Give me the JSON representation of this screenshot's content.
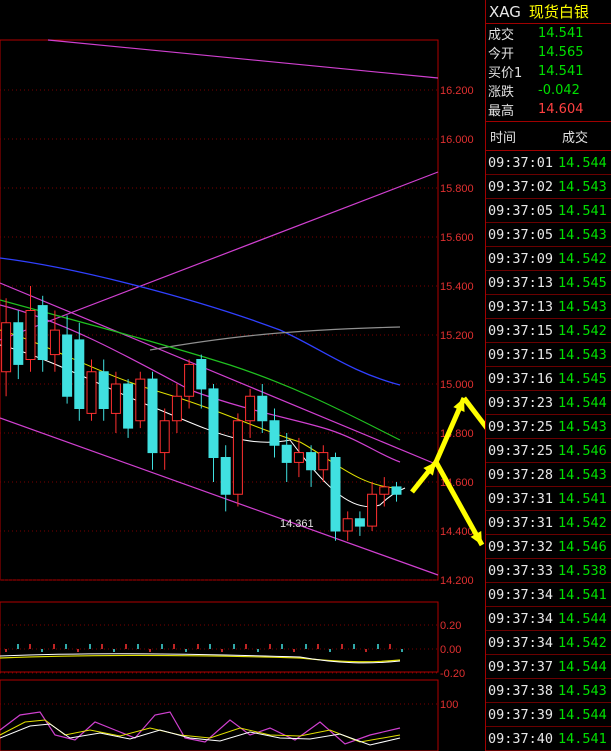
{
  "panel": {
    "symbol": "XAG",
    "name": "现货白银",
    "quotes": [
      {
        "label": "成交",
        "value": "14.541",
        "color": "#00e000"
      },
      {
        "label": "今开",
        "value": "14.565",
        "color": "#00e000"
      },
      {
        "label": "买价1",
        "value": "14.541",
        "color": "#00e000"
      },
      {
        "label": "涨跌",
        "value": "-0.042",
        "color": "#00e000"
      },
      {
        "label": "最高",
        "value": "14.604",
        "color": "#ff4040"
      }
    ],
    "header_time": "时间",
    "header_price": "成交",
    "ticks": [
      {
        "time": "09:37:01",
        "price": "14.544"
      },
      {
        "time": "09:37:02",
        "price": "14.543"
      },
      {
        "time": "09:37:05",
        "price": "14.541"
      },
      {
        "time": "09:37:05",
        "price": "14.543"
      },
      {
        "time": "09:37:09",
        "price": "14.542"
      },
      {
        "time": "09:37:13",
        "price": "14.545"
      },
      {
        "time": "09:37:13",
        "price": "14.543"
      },
      {
        "time": "09:37:15",
        "price": "14.542"
      },
      {
        "time": "09:37:15",
        "price": "14.543"
      },
      {
        "time": "09:37:16",
        "price": "14.545"
      },
      {
        "time": "09:37:23",
        "price": "14.544"
      },
      {
        "time": "09:37:25",
        "price": "14.543"
      },
      {
        "time": "09:37:25",
        "price": "14.546"
      },
      {
        "time": "09:37:28",
        "price": "14.543"
      },
      {
        "time": "09:37:31",
        "price": "14.541"
      },
      {
        "time": "09:37:31",
        "price": "14.542"
      },
      {
        "time": "09:37:32",
        "price": "14.546"
      },
      {
        "time": "09:37:33",
        "price": "14.538"
      },
      {
        "time": "09:37:34",
        "price": "14.541"
      },
      {
        "time": "09:37:34",
        "price": "14.544"
      },
      {
        "time": "09:37:34",
        "price": "14.542"
      },
      {
        "time": "09:37:37",
        "price": "14.544"
      },
      {
        "time": "09:37:38",
        "price": "14.543"
      },
      {
        "time": "09:37:39",
        "price": "14.544"
      },
      {
        "time": "09:37:40",
        "price": "14.541"
      }
    ]
  },
  "chart": {
    "price_ticks": [
      "16.200",
      "16.000",
      "15.800",
      "15.600",
      "15.400",
      "15.200",
      "15.000",
      "14.800",
      "14.600",
      "14.400",
      "14.200"
    ],
    "price_values": [
      16.2,
      16.0,
      15.8,
      15.6,
      15.4,
      15.2,
      15.0,
      14.8,
      14.6,
      14.4,
      14.2
    ],
    "low_label": "14.361",
    "macd_ticks": [
      "0.20",
      "0.00",
      "-0.20"
    ],
    "kdj_ticks": [
      "100"
    ],
    "candles": [
      [
        0.5,
        15.05,
        15.25,
        14.95,
        15.35
      ],
      [
        1.5,
        15.25,
        15.08,
        15.02,
        15.3
      ],
      [
        2.5,
        15.1,
        15.3,
        15.05,
        15.4
      ],
      [
        3.5,
        15.32,
        15.1,
        15.05,
        15.36
      ],
      [
        4.5,
        15.12,
        15.22,
        15.05,
        15.3
      ],
      [
        5.5,
        15.2,
        14.95,
        14.92,
        15.28
      ],
      [
        6.5,
        15.18,
        14.9,
        14.85,
        15.25
      ],
      [
        7.5,
        14.88,
        15.05,
        14.85,
        15.1
      ],
      [
        8.5,
        15.05,
        14.9,
        14.85,
        15.1
      ],
      [
        9.5,
        14.88,
        15.0,
        14.8,
        15.05
      ],
      [
        10.5,
        15.0,
        14.82,
        14.78,
        15.02
      ],
      [
        11.5,
        14.85,
        15.02,
        14.82,
        15.05
      ],
      [
        12.5,
        15.02,
        14.72,
        14.65,
        15.05
      ],
      [
        13.5,
        14.72,
        14.85,
        14.65,
        14.9
      ],
      [
        14.5,
        14.85,
        14.95,
        14.8,
        15.0
      ],
      [
        15.5,
        14.95,
        15.08,
        14.9,
        15.1
      ],
      [
        16.5,
        15.1,
        14.98,
        14.9,
        15.12
      ],
      [
        17.5,
        14.98,
        14.7,
        14.6,
        15.0
      ],
      [
        18.5,
        14.7,
        14.55,
        14.48,
        14.75
      ],
      [
        19.5,
        14.55,
        14.85,
        14.5,
        14.88
      ],
      [
        20.5,
        14.85,
        14.95,
        14.78,
        14.98
      ],
      [
        21.5,
        14.95,
        14.85,
        14.8,
        15.0
      ],
      [
        22.5,
        14.85,
        14.75,
        14.7,
        14.9
      ],
      [
        23.5,
        14.75,
        14.68,
        14.6,
        14.8
      ],
      [
        24.5,
        14.68,
        14.72,
        14.62,
        14.78
      ],
      [
        25.5,
        14.72,
        14.65,
        14.58,
        14.75
      ],
      [
        26.5,
        14.65,
        14.72,
        14.6,
        14.75
      ],
      [
        27.5,
        14.7,
        14.4,
        14.36,
        14.72
      ],
      [
        28.5,
        14.4,
        14.45,
        14.36,
        14.48
      ],
      [
        29.5,
        14.45,
        14.42,
        14.38,
        14.48
      ],
      [
        30.5,
        14.42,
        14.55,
        14.4,
        14.6
      ],
      [
        31.5,
        14.55,
        14.58,
        14.5,
        14.62
      ],
      [
        32.5,
        14.58,
        14.55,
        14.52,
        14.6
      ]
    ]
  }
}
